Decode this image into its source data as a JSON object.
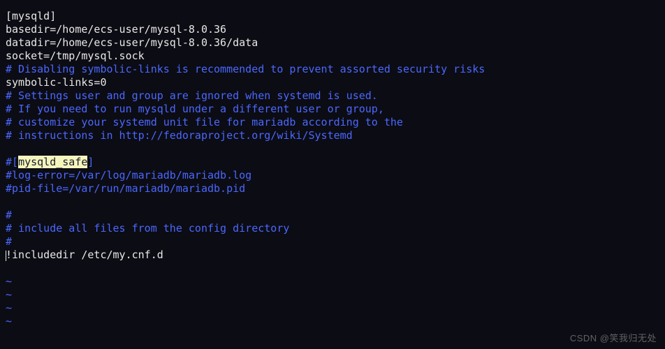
{
  "lines": [
    {
      "cls": "white",
      "text": "[mysqld]"
    },
    {
      "cls": "white",
      "text": "basedir=/home/ecs-user/mysql-8.0.36"
    },
    {
      "cls": "white",
      "text": "datadir=/home/ecs-user/mysql-8.0.36/data"
    },
    {
      "cls": "white",
      "text": "socket=/tmp/mysql.sock"
    },
    {
      "cls": "comment",
      "text": "# Disabling symbolic-links is recommended to prevent assorted security risks"
    },
    {
      "cls": "white",
      "text": "symbolic-links=0"
    },
    {
      "cls": "comment",
      "text": "# Settings user and group are ignored when systemd is used."
    },
    {
      "cls": "comment",
      "text": "# If you need to run mysqld under a different user or group,"
    },
    {
      "cls": "comment",
      "text": "# customize your systemd unit file for mariadb according to the"
    },
    {
      "cls": "comment",
      "text": "# instructions in http://fedoraproject.org/wiki/Systemd"
    },
    {
      "cls": "white",
      "text": ""
    },
    {
      "cls": "mixed",
      "parts": [
        {
          "cls": "comment",
          "text": "#["
        },
        {
          "cls": "hl",
          "text": "mysqld_safe"
        },
        {
          "cls": "comment",
          "text": "]"
        }
      ]
    },
    {
      "cls": "comment",
      "text": "#log-error=/var/log/mariadb/mariadb.log"
    },
    {
      "cls": "comment",
      "text": "#pid-file=/var/run/mariadb/mariadb.pid"
    },
    {
      "cls": "white",
      "text": ""
    },
    {
      "cls": "comment",
      "text": "#"
    },
    {
      "cls": "comment",
      "text": "# include all files from the config directory"
    },
    {
      "cls": "comment",
      "text": "#"
    },
    {
      "cls": "white",
      "text": "!includedir /etc/my.cnf.d",
      "cursor": true
    },
    {
      "cls": "white",
      "text": ""
    },
    {
      "cls": "tilde",
      "text": "~"
    },
    {
      "cls": "tilde",
      "text": "~"
    },
    {
      "cls": "tilde",
      "text": "~"
    },
    {
      "cls": "tilde",
      "text": "~"
    }
  ],
  "watermark": "CSDN @笑我归无处"
}
